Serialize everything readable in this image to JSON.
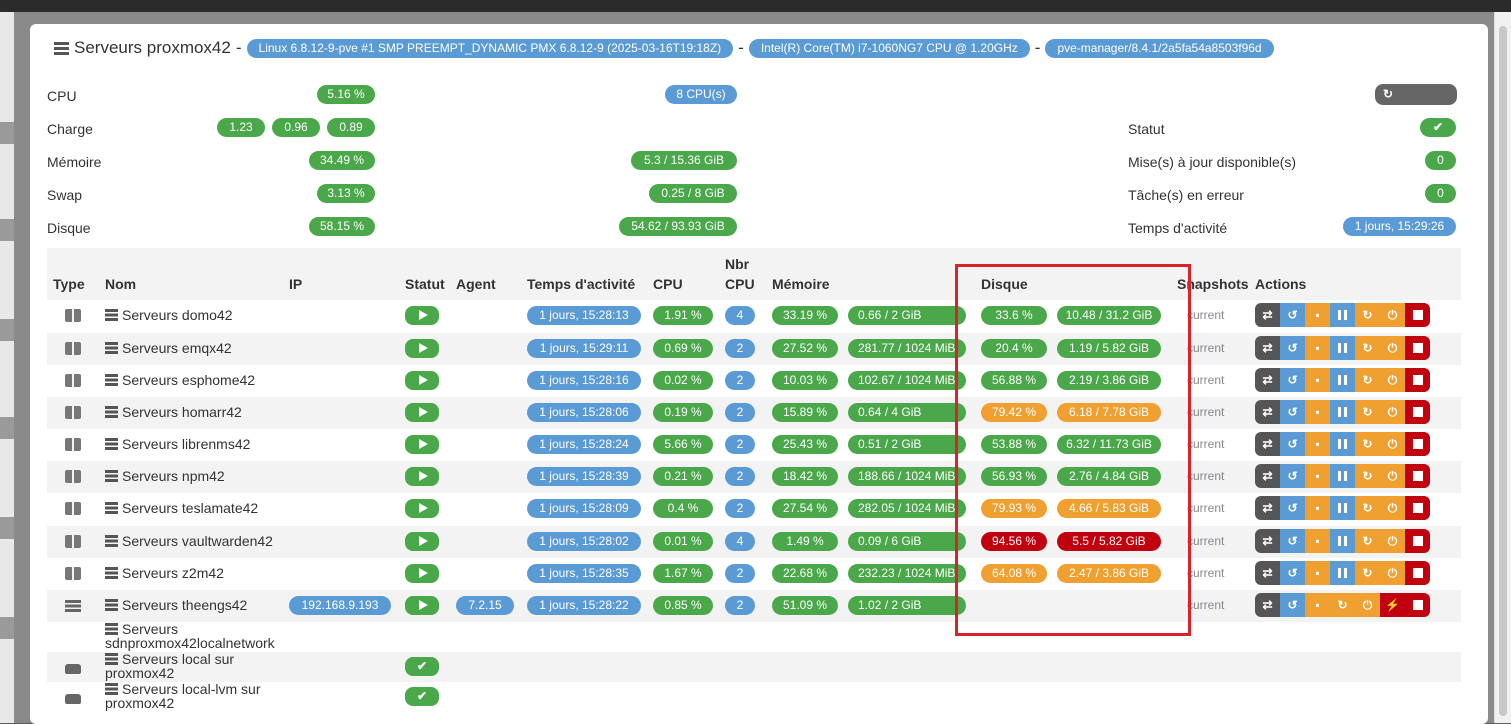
{
  "header": {
    "title": "Serveurs proxmox42",
    "tags": [
      "Linux 6.8.12-9-pve #1 SMP PREEMPT_DYNAMIC PMX 6.8.12-9 (2025-03-16T19:18Z)",
      "Intel(R) Core(TM) i7-1060NG7 CPU @ 1.20GHz",
      "pve-manager/8.4.1/2a5fa54a8503f96d"
    ],
    "separator": "-"
  },
  "stats": {
    "cpu_label": "CPU",
    "cpu_pct": "5.16 %",
    "cpu_count": "8 CPU(s)",
    "load_label": "Charge",
    "load": [
      "1.23",
      "0.96",
      "0.89"
    ],
    "mem_label": "Mémoire",
    "mem_pct": "34.49 %",
    "mem_val": "5.3 / 15.36 GiB",
    "swap_label": "Swap",
    "swap_pct": "3.13 %",
    "swap_val": "0.25 / 8 GiB",
    "disk_label": "Disque",
    "disk_pct": "58.15 %",
    "disk_val": "54.62 / 93.93 GiB",
    "refresh_label": "Rafraichir",
    "status_label": "Statut",
    "status_icon": "check-icon",
    "updates_label": "Mise(s) à jour disponible(s)",
    "updates": "0",
    "errors_label": "Tâche(s) en erreur",
    "errors": "0",
    "uptime_label": "Temps d'activité",
    "uptime": "1 jours, 15:29:26"
  },
  "table": {
    "headers": {
      "type": "Type",
      "name": "Nom",
      "ip": "IP",
      "status": "Statut",
      "agent": "Agent",
      "uptime": "Temps d'activité",
      "cpu": "CPU",
      "nbcpu_1": "Nbr",
      "nbcpu_2": "CPU",
      "mem": "Mémoire",
      "disk": "Disque",
      "snap": "Snapshots",
      "actions": "Actions"
    },
    "rows": [
      {
        "name": "Serveurs domo42",
        "uptime": "1 jours, 15:28:13",
        "cpu": "1.91 %",
        "ncpu": "4",
        "mem_pct": "33.19 %",
        "mem_val": "0.66 / 2 GiB",
        "disk_pct": "33.6 %",
        "disk_val": "10.48 / 31.2 GiB",
        "disk_color": "green",
        "snap": "current"
      },
      {
        "name": "Serveurs emqx42",
        "uptime": "1 jours, 15:29:11",
        "cpu": "0.69 %",
        "ncpu": "2",
        "mem_pct": "27.52 %",
        "mem_val": "281.77 / 1024 MiB",
        "disk_pct": "20.4 %",
        "disk_val": "1.19 / 5.82 GiB",
        "disk_color": "green",
        "snap": "current"
      },
      {
        "name": "Serveurs esphome42",
        "uptime": "1 jours, 15:28:16",
        "cpu": "0.02 %",
        "ncpu": "2",
        "mem_pct": "10.03 %",
        "mem_val": "102.67 / 1024 MiB",
        "disk_pct": "56.88 %",
        "disk_val": "2.19 / 3.86 GiB",
        "disk_color": "green",
        "snap": "current"
      },
      {
        "name": "Serveurs homarr42",
        "uptime": "1 jours, 15:28:06",
        "cpu": "0.19 %",
        "ncpu": "2",
        "mem_pct": "15.89 %",
        "mem_val": "0.64 / 4 GiB",
        "disk_pct": "79.42 %",
        "disk_val": "6.18 / 7.78 GiB",
        "disk_color": "orange",
        "snap": "current"
      },
      {
        "name": "Serveurs librenms42",
        "uptime": "1 jours, 15:28:24",
        "cpu": "5.66 %",
        "ncpu": "2",
        "mem_pct": "25.43 %",
        "mem_val": "0.51 / 2 GiB",
        "disk_pct": "53.88 %",
        "disk_val": "6.32 / 11.73 GiB",
        "disk_color": "green",
        "snap": "current"
      },
      {
        "name": "Serveurs npm42",
        "uptime": "1 jours, 15:28:39",
        "cpu": "0.21 %",
        "ncpu": "2",
        "mem_pct": "18.42 %",
        "mem_val": "188.66 / 1024 MiB",
        "disk_pct": "56.93 %",
        "disk_val": "2.76 / 4.84 GiB",
        "disk_color": "green",
        "snap": "current"
      },
      {
        "name": "Serveurs teslamate42",
        "uptime": "1 jours, 15:28:09",
        "cpu": "0.4 %",
        "ncpu": "2",
        "mem_pct": "27.54 %",
        "mem_val": "282.05 / 1024 MiB",
        "disk_pct": "79.93 %",
        "disk_val": "4.66 / 5.83 GiB",
        "disk_color": "orange",
        "snap": "current"
      },
      {
        "name": "Serveurs vaultwarden42",
        "uptime": "1 jours, 15:28:02",
        "cpu": "0.01 %",
        "ncpu": "4",
        "mem_pct": "1.49 %",
        "mem_val": "0.09 / 6 GiB",
        "disk_pct": "94.56 %",
        "disk_val": "5.5 / 5.82 GiB",
        "disk_color": "red",
        "snap": "current"
      },
      {
        "name": "Serveurs z2m42",
        "uptime": "1 jours, 15:28:35",
        "cpu": "1.67 %",
        "ncpu": "2",
        "mem_pct": "22.68 %",
        "mem_val": "232.23 / 1024 MiB",
        "disk_pct": "64.08 %",
        "disk_val": "2.47 / 3.86 GiB",
        "disk_color": "orange",
        "snap": "current"
      },
      {
        "name": "Serveurs theengs42",
        "ip": "192.168.9.193",
        "agent": "7.2.15",
        "uptime": "1 jours, 15:28:22",
        "cpu": "0.85 %",
        "ncpu": "2",
        "mem_pct": "51.09 %",
        "mem_val": "1.02 / 2 GiB",
        "snap": "current"
      }
    ],
    "storage": [
      {
        "name_1": "Serveurs",
        "name_2": "sdnproxmox42localnetwork"
      },
      {
        "name_1": "Serveurs local sur",
        "name_2": "proxmox42"
      },
      {
        "name_1": "Serveurs local-lvm sur",
        "name_2": "proxmox42"
      }
    ],
    "colors": {
      "green": "#4aa84a",
      "blue": "#5b9bd5",
      "orange": "#f0a030",
      "red": "#c0000e",
      "highlight_box": "#d8232a"
    }
  }
}
